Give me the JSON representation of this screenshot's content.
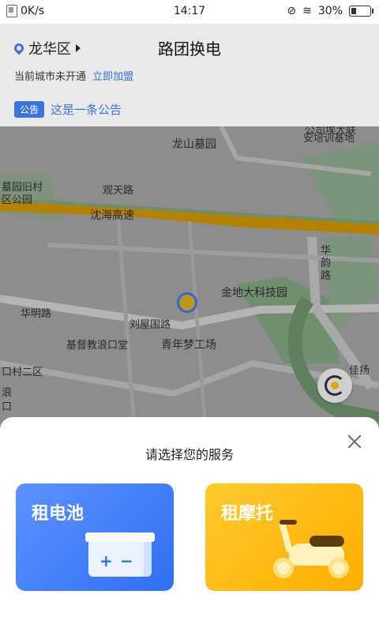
{
  "status_bar": {
    "speed": "0K/s",
    "time": "14:17",
    "battery_percent": "30%"
  },
  "header": {
    "city": "龙华区",
    "title": "路团换电",
    "not_open_text": "当前城市未开通",
    "join_link": "立即加盟",
    "announcement_badge": "公告",
    "announcement_text": "这是一条公告"
  },
  "map": {
    "labels": [
      "龙山墓园",
      "公司埃大联",
      "安培训基地",
      "墓园旧村",
      "区公园",
      "观天路",
      "沈海高速",
      "华",
      "韵",
      "路",
      "金地大科技园",
      "华明路",
      "刘屋围路",
      "基督教浪口堂",
      "青年梦工场",
      "口村二区",
      "佳扬",
      "浪",
      "口"
    ]
  },
  "sheet": {
    "title": "请选择您的服务",
    "options": [
      {
        "label": "租电池"
      },
      {
        "label": "租摩托"
      }
    ]
  },
  "colors": {
    "accent_blue": "#2f6ff3",
    "accent_yellow": "#ffad00"
  }
}
